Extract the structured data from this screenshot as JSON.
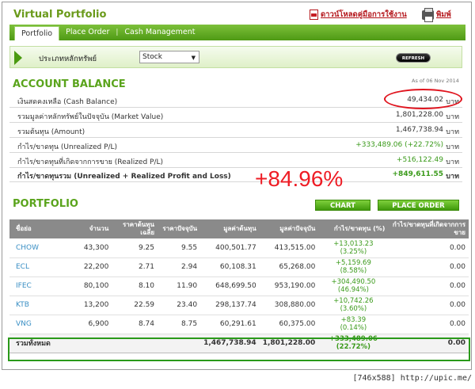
{
  "header": {
    "title": "Virtual Portfolio",
    "manual_link": "ดาวน์โหลดคู่มือการใช้งาน",
    "print_link": "พิมพ์"
  },
  "nav": {
    "tabs": [
      {
        "label": "Portfolio",
        "active": true
      },
      {
        "label": "Place Order",
        "active": false
      },
      {
        "label": "Cash Management",
        "active": false
      }
    ]
  },
  "filter": {
    "label": "ประเภทหลักทรัพย์",
    "selected": "Stock",
    "refresh_label": "REFRESH"
  },
  "account_balance": {
    "title": "ACCOUNT BALANCE",
    "as_of": "As of 06 Nov 2014",
    "rows": [
      {
        "label": "เงินสดคงเหลือ (Cash Balance)",
        "value": "49,434.02",
        "unit": "บาท"
      },
      {
        "label": "รวมมูลค่าหลักทรัพย์ในปัจจุบัน (Market Value)",
        "value": "1,801,228.00",
        "unit": "บาท"
      },
      {
        "label": "รวมต้นทุน (Amount)",
        "value": "1,467,738.94",
        "unit": "บาท"
      },
      {
        "label": "กำไร/ขาดทุน (Unrealized P/L)",
        "value": "+333,489.06 (+22.72%)",
        "unit": "บาท"
      },
      {
        "label": "กำไร/ขาดทุนที่เกิดจากการขาย (Realized P/L)",
        "value": "+516,122.49",
        "unit": "บาท"
      },
      {
        "label": "กำไร/ขาดทุนรวม (Unrealized + Realized Profit and Loss)",
        "value": "+849,611.55",
        "unit": "บาท"
      }
    ],
    "annotation_pct": "+84.96%"
  },
  "portfolio": {
    "title": "PORTFOLIO",
    "chart_button": "CHART",
    "place_order_button": "PLACE ORDER",
    "headers": [
      "ชื่อย่อ",
      "จำนวน",
      "ราคาต้นทุนเฉลี่ย",
      "ราคาปัจจุบัน",
      "มูลค่าต้นทุน",
      "มูลค่าปัจจุบัน",
      "กำไร/ขาดทุน (%)",
      "กำไร/ขาดทุนที่เกิดจากการขาย"
    ],
    "rows": [
      {
        "symbol": "CHOW",
        "qty": "43,300",
        "avg": "9.25",
        "price": "9.55",
        "cost": "400,501.77",
        "mkt": "413,515.00",
        "pl": "+13,013.23",
        "pl_pct": "(3.25%)",
        "realized": "0.00"
      },
      {
        "symbol": "ECL",
        "qty": "22,200",
        "avg": "2.71",
        "price": "2.94",
        "cost": "60,108.31",
        "mkt": "65,268.00",
        "pl": "+5,159.69",
        "pl_pct": "(8.58%)",
        "realized": "0.00"
      },
      {
        "symbol": "IFEC",
        "qty": "80,100",
        "avg": "8.10",
        "price": "11.90",
        "cost": "648,699.50",
        "mkt": "953,190.00",
        "pl": "+304,490.50",
        "pl_pct": "(46.94%)",
        "realized": "0.00"
      },
      {
        "symbol": "KTB",
        "qty": "13,200",
        "avg": "22.59",
        "price": "23.40",
        "cost": "298,137.74",
        "mkt": "308,880.00",
        "pl": "+10,742.26",
        "pl_pct": "(3.60%)",
        "realized": "0.00"
      },
      {
        "symbol": "VNG",
        "qty": "6,900",
        "avg": "8.74",
        "price": "8.75",
        "cost": "60,291.61",
        "mkt": "60,375.00",
        "pl": "+83.39",
        "pl_pct": "(0.14%)",
        "realized": "0.00"
      }
    ],
    "total": {
      "label": "รวมทั้งหมด",
      "cost": "1,467,738.94",
      "mkt": "1,801,228.00",
      "pl": "+333,489.06",
      "pl_pct": "(22.72%)",
      "realized": "0.00"
    }
  },
  "footer": {
    "text": "[746x588] http://upic.me/"
  }
}
